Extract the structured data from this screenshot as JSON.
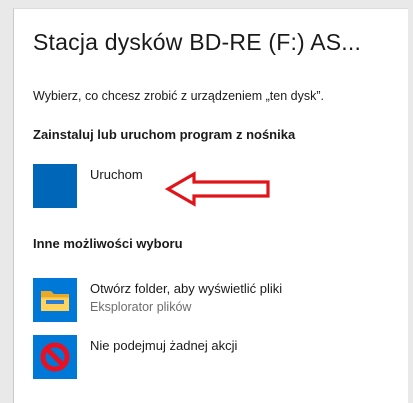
{
  "dialog": {
    "title": "Stacja dysków BD-RE (F:) AS...",
    "prompt": "Wybierz, co chcesz zrobić z urządzeniem „ten dysk”."
  },
  "sections": {
    "install": {
      "heading": "Zainstaluj lub uruchom program z nośnika",
      "options": [
        {
          "label": "Uruchom",
          "icon": "app-tile-icon"
        }
      ]
    },
    "other": {
      "heading": "Inne możliwości wyboru",
      "options": [
        {
          "label": "Otwórz folder, aby wyświetlić pliki",
          "sublabel": "Eksplorator plików",
          "icon": "folder-icon"
        },
        {
          "label": "Nie podejmuj żadnej akcji",
          "icon": "no-action-icon"
        }
      ]
    }
  },
  "annotation": {
    "arrow_color": "#e0141b",
    "arrow_icon": "left-arrow-icon"
  },
  "colors": {
    "tile_blue": "#0067b8",
    "no_action_red": "#e81123"
  }
}
